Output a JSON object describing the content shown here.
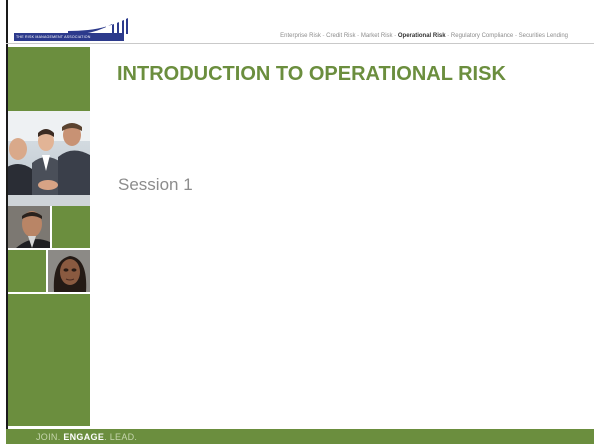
{
  "header": {
    "logo_tagline": "THE RISK MANAGEMENT ASSOCIATION",
    "nav": [
      {
        "label": "Enterprise Risk",
        "active": false
      },
      {
        "label": "Credit Risk",
        "active": false
      },
      {
        "label": "Market Risk",
        "active": false
      },
      {
        "label": "Operational Risk",
        "active": true
      },
      {
        "label": "Regulatory Compliance",
        "active": false
      },
      {
        "label": "Securities Lending",
        "active": false
      }
    ],
    "nav_separator": " - "
  },
  "slide": {
    "title": "INTRODUCTION TO OPERATIONAL RISK",
    "subtitle": "Session 1"
  },
  "footer": {
    "slogan_part1": "JOIN. ",
    "slogan_part2": "ENGAGE",
    "slogan_part3": ". LEAD."
  },
  "colors": {
    "accent_green": "#6b8e3e",
    "logo_blue": "#2c3a8c",
    "text_gray": "#8c8c8c"
  }
}
